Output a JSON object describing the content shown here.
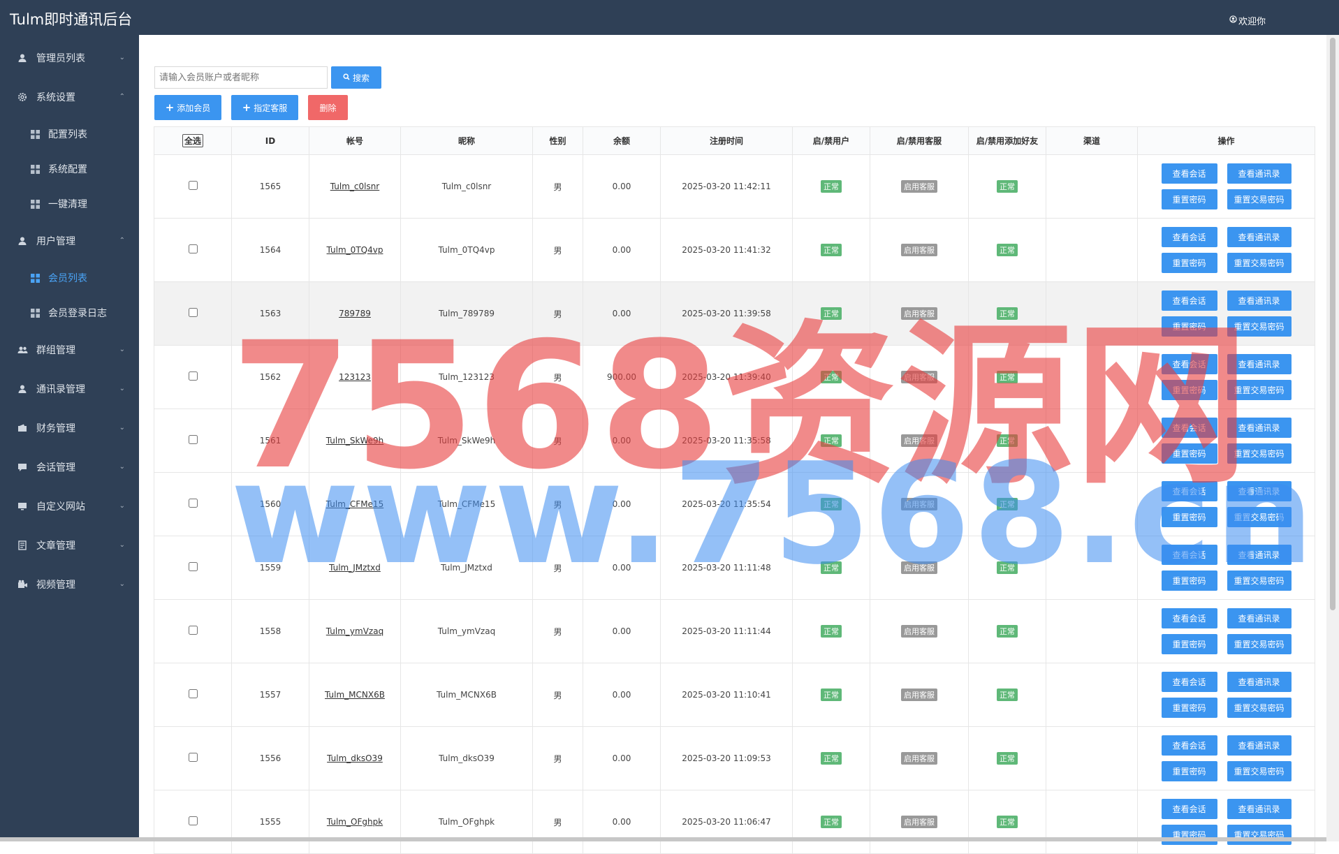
{
  "app": {
    "title": "Tulm即时通讯后台",
    "welcome": "欢迎你"
  },
  "sidebar": {
    "items": [
      {
        "label": "管理员列表",
        "icon": "user-icon",
        "chevron": "down"
      },
      {
        "label": "系统设置",
        "icon": "gear-icon",
        "chevron": "up",
        "children": [
          {
            "label": "配置列表"
          },
          {
            "label": "系统配置"
          },
          {
            "label": "一键清理"
          }
        ]
      },
      {
        "label": "用户管理",
        "icon": "user-icon",
        "chevron": "up",
        "children": [
          {
            "label": "会员列表",
            "active": true
          },
          {
            "label": "会员登录日志"
          }
        ]
      },
      {
        "label": "群组管理",
        "icon": "group-icon",
        "chevron": "down"
      },
      {
        "label": "通讯录管理",
        "icon": "user-icon",
        "chevron": "down"
      },
      {
        "label": "财务管理",
        "icon": "finance-icon",
        "chevron": "down"
      },
      {
        "label": "会话管理",
        "icon": "chat-icon",
        "chevron": "down"
      },
      {
        "label": "自定义网站",
        "icon": "monitor-icon",
        "chevron": "down"
      },
      {
        "label": "文章管理",
        "icon": "document-icon",
        "chevron": "down"
      },
      {
        "label": "视频管理",
        "icon": "video-icon",
        "chevron": "down"
      }
    ]
  },
  "toolbar": {
    "search_placeholder": "请输入会员账户或者昵称",
    "search_label": "搜索",
    "add_member_label": "添加会员",
    "assign_cs_label": "指定客服",
    "delete_label": "删除"
  },
  "table": {
    "headers": [
      "全选",
      "ID",
      "帐号",
      "昵称",
      "性别",
      "余额",
      "注册时间",
      "启/禁用户",
      "启/禁用客服",
      "启/禁用添加好友",
      "渠道",
      "操作"
    ],
    "op_labels": {
      "view_chat": "查看会话",
      "view_contacts": "查看通讯录",
      "reset_pwd": "重置密码",
      "reset_trade_pwd": "重置交易密码"
    },
    "rows": [
      {
        "id": "1565",
        "account": "Tulm_c0lsnr",
        "nickname": "Tulm_c0lsnr",
        "gender": "男",
        "balance": "0.00",
        "reg_time": "2025-03-20 11:42:11",
        "user_status": "正常",
        "cs_status": "启用客服",
        "friend_status": "正常",
        "channel": ""
      },
      {
        "id": "1564",
        "account": "Tulm_0TQ4vp",
        "nickname": "Tulm_0TQ4vp",
        "gender": "男",
        "balance": "0.00",
        "reg_time": "2025-03-20 11:41:32",
        "user_status": "正常",
        "cs_status": "启用客服",
        "friend_status": "正常",
        "channel": ""
      },
      {
        "id": "1563",
        "account": "789789",
        "nickname": "Tulm_789789",
        "gender": "男",
        "balance": "0.00",
        "reg_time": "2025-03-20 11:39:58",
        "user_status": "正常",
        "cs_status": "启用客服",
        "friend_status": "正常",
        "channel": "",
        "highlight": true
      },
      {
        "id": "1562",
        "account": "123123",
        "nickname": "Tulm_123123",
        "gender": "男",
        "balance": "900.00",
        "reg_time": "2025-03-20 11:39:40",
        "user_status": "正常",
        "cs_status": "启用客服",
        "friend_status": "正常",
        "channel": ""
      },
      {
        "id": "1561",
        "account": "Tulm_SkWe9h",
        "nickname": "Tulm_SkWe9h",
        "gender": "男",
        "balance": "0.00",
        "reg_time": "2025-03-20 11:35:58",
        "user_status": "正常",
        "cs_status": "启用客服",
        "friend_status": "正常",
        "channel": ""
      },
      {
        "id": "1560",
        "account": "Tulm_CFMe15",
        "nickname": "Tulm_CFMe15",
        "gender": "男",
        "balance": "0.00",
        "reg_time": "2025-03-20 11:35:54",
        "user_status": "正常",
        "cs_status": "启用客服",
        "friend_status": "正常",
        "channel": ""
      },
      {
        "id": "1559",
        "account": "Tulm_JMztxd",
        "nickname": "Tulm_JMztxd",
        "gender": "男",
        "balance": "0.00",
        "reg_time": "2025-03-20 11:11:48",
        "user_status": "正常",
        "cs_status": "启用客服",
        "friend_status": "正常",
        "channel": ""
      },
      {
        "id": "1558",
        "account": "Tulm_ymVzaq",
        "nickname": "Tulm_ymVzaq",
        "gender": "男",
        "balance": "0.00",
        "reg_time": "2025-03-20 11:11:44",
        "user_status": "正常",
        "cs_status": "启用客服",
        "friend_status": "正常",
        "channel": ""
      },
      {
        "id": "1557",
        "account": "Tulm_MCNX6B",
        "nickname": "Tulm_MCNX6B",
        "gender": "男",
        "balance": "0.00",
        "reg_time": "2025-03-20 11:10:41",
        "user_status": "正常",
        "cs_status": "启用客服",
        "friend_status": "正常",
        "channel": ""
      },
      {
        "id": "1556",
        "account": "Tulm_dksO39",
        "nickname": "Tulm_dksO39",
        "gender": "男",
        "balance": "0.00",
        "reg_time": "2025-03-20 11:09:53",
        "user_status": "正常",
        "cs_status": "启用客服",
        "friend_status": "正常",
        "channel": ""
      },
      {
        "id": "1555",
        "account": "Tulm_OFghpk",
        "nickname": "Tulm_OFghpk",
        "gender": "男",
        "balance": "0.00",
        "reg_time": "2025-03-20 11:06:47",
        "user_status": "正常",
        "cs_status": "启用客服",
        "friend_status": "正常",
        "channel": ""
      }
    ]
  },
  "watermark": {
    "line1": "7568资源网",
    "line2": "www.7568.cn"
  },
  "colors": {
    "sidebar_bg": "#2f4056",
    "primary": "#3b95f0",
    "danger": "#f06868",
    "success": "#5fb878",
    "muted": "#999999",
    "active_menu": "#4aa3f5"
  }
}
